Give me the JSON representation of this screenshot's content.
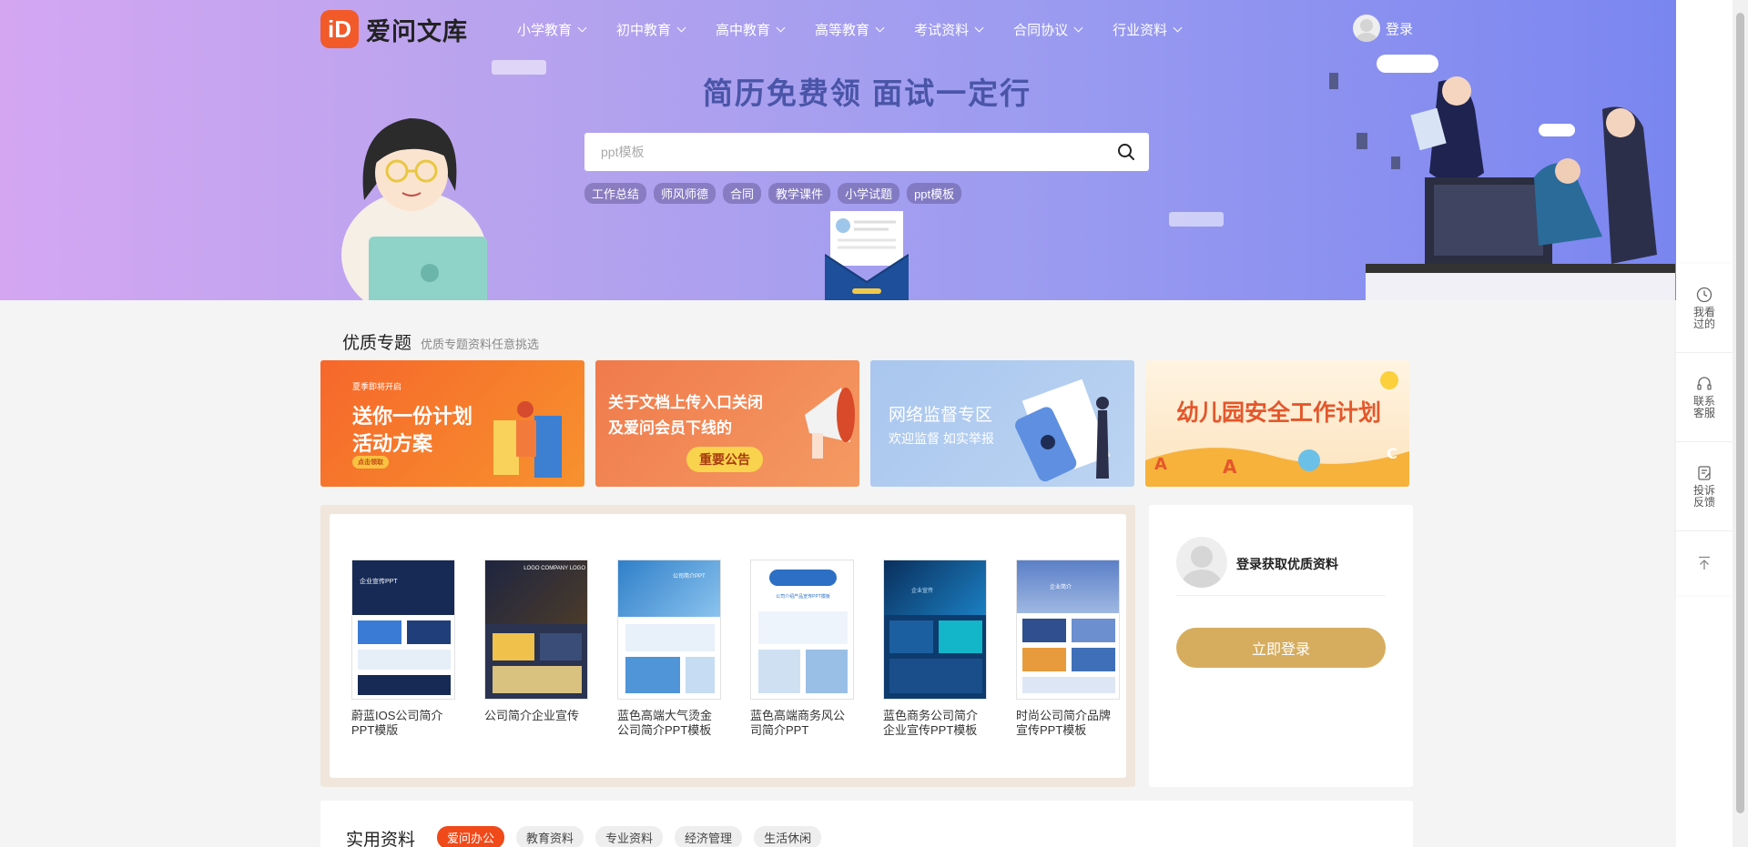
{
  "brand": {
    "logo_mark": "iD",
    "name": "爱问文库"
  },
  "nav": {
    "items": [
      {
        "label": "小学教育"
      },
      {
        "label": "初中教育"
      },
      {
        "label": "高中教育"
      },
      {
        "label": "高等教育"
      },
      {
        "label": "考试资料"
      },
      {
        "label": "合同协议"
      },
      {
        "label": "行业资料"
      }
    ],
    "login_label": "登录"
  },
  "hero": {
    "title": "简历免费领 面试一定行",
    "search_placeholder": "ppt模板",
    "hot_tags": [
      "工作总结",
      "师风师德",
      "合同",
      "教学课件",
      "小学试题",
      "ppt模板"
    ]
  },
  "topics": {
    "title": "优质专题",
    "subtitle": "优质专题资料任意挑选",
    "banners": [
      {
        "kicker": "夏季即将开启",
        "line1": "送你一份计划",
        "line2": "活动方案",
        "badge": "点击领取"
      },
      {
        "line1": "关于文档上传入口关闭",
        "line2": "及爱问会员下线的",
        "badge": "重要公告"
      },
      {
        "line1": "网络监督专区",
        "line2": "欢迎监督 如实举报"
      },
      {
        "line1": "幼儿园安全工作计划"
      }
    ]
  },
  "docs": [
    {
      "title": "蔚蓝IOS公司简介PPT模版",
      "thumb": "企业宣传PPT"
    },
    {
      "title": "公司简介企业宣传",
      "thumb": "LOGO COMPANY LOGO"
    },
    {
      "title": "蓝色高端大气烫金公司简介PPT模板",
      "thumb": "公司简介PPT"
    },
    {
      "title": "蓝色高端商务风公司简介PPT",
      "thumb": "公司介绍产品宣传PPT模板"
    },
    {
      "title": "蓝色商务公司简介企业宣传PPT模板",
      "thumb": "企业宣传"
    },
    {
      "title": "时尚公司简介品牌宣传PPT模板",
      "thumb": "企业简介"
    }
  ],
  "login_box": {
    "text": "登录获取优质资料",
    "button": "立即登录"
  },
  "side": {
    "items": [
      {
        "label": "我看过的",
        "icon": "clock-icon"
      },
      {
        "label": "联系客服",
        "icon": "headset-icon"
      },
      {
        "label": "投诉反馈",
        "icon": "feedback-icon"
      }
    ]
  },
  "practical": {
    "title": "实用资料",
    "tabs": [
      "爱问办公",
      "教育资料",
      "专业资料",
      "经济管理",
      "生活休闲"
    ]
  },
  "colors": {
    "accent": "#f04a1a",
    "gold": "#d6ad5e",
    "hero_title": "#4a55a8"
  }
}
